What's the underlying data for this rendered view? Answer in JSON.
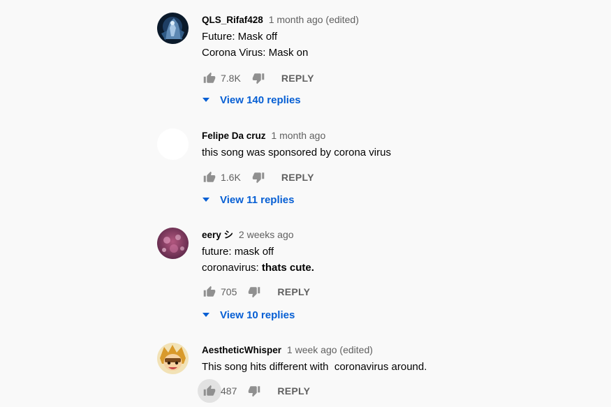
{
  "comments": [
    {
      "author": "QLS_Rifaf428",
      "time": "1 month ago (edited)",
      "lines": [
        "Future: Mask off",
        "Corona Virus: Mask on"
      ],
      "likes": "7.8K",
      "reply_label": "REPLY",
      "view_replies": "View 140 replies",
      "avatar": "dark-blue-character-avatar"
    },
    {
      "author": "Felipe Da cruz",
      "time": "1 month ago",
      "lines": [
        "this song was sponsored by corona virus"
      ],
      "likes": "1.6K",
      "reply_label": "REPLY",
      "view_replies": "View 11 replies",
      "avatar": "blank-white-avatar"
    },
    {
      "author": "eery シ",
      "time": "2 weeks ago",
      "line1": "future: mask off",
      "line2_prefix": "coronavirus: ",
      "line2_bold": "thats cute.",
      "likes": "705",
      "reply_label": "REPLY",
      "view_replies": "View 10 replies",
      "avatar": "pink-bokeh-avatar"
    },
    {
      "author": "AestheticWhisper",
      "time": "1 week ago (edited)",
      "lines": [
        "This song hits different with  coronavirus around."
      ],
      "likes": "487",
      "reply_label": "REPLY",
      "avatar": "cartoon-character-avatar"
    }
  ],
  "colors": {
    "background": "#f9f9f9",
    "text": "#030303",
    "secondary_text": "#606060",
    "link_blue": "#065fd4"
  },
  "icons": [
    "thumb-up-icon",
    "thumb-down-icon",
    "chevron-down-icon"
  ]
}
